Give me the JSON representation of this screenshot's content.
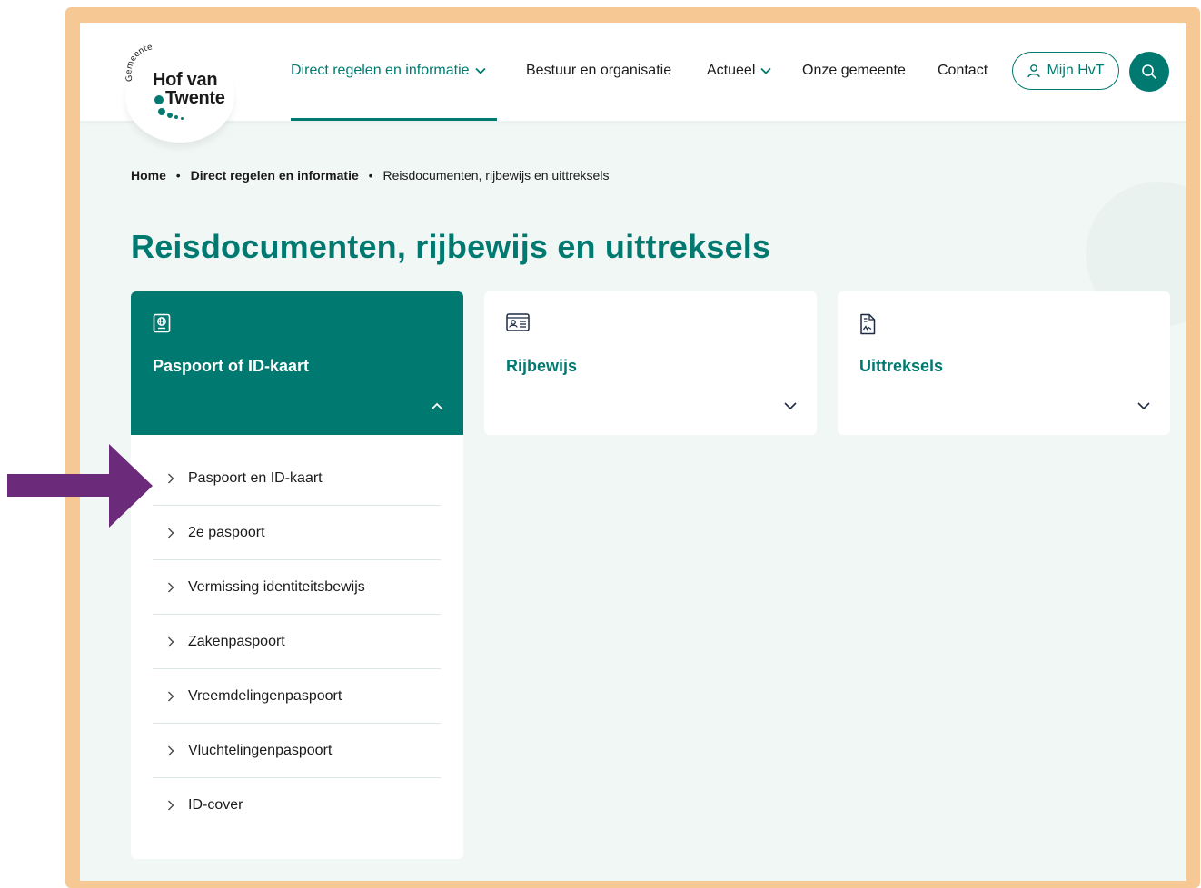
{
  "colors": {
    "brand": "#007a70",
    "frame": "#f5c894",
    "background": "#f1f7f5",
    "pointer_arrow": "#6b2a7a"
  },
  "logo": {
    "small": "Gemeente",
    "line1": "Hof van",
    "line2": "Twente"
  },
  "nav": {
    "items": [
      {
        "label": "Direct regelen en informatie",
        "active": true,
        "has_dropdown": true
      },
      {
        "label": "Bestuur en organisatie",
        "active": false,
        "has_dropdown": false
      },
      {
        "label": "Actueel",
        "active": false,
        "has_dropdown": true
      },
      {
        "label": "Onze gemeente",
        "active": false,
        "has_dropdown": false
      },
      {
        "label": "Contact",
        "active": false,
        "has_dropdown": false
      }
    ],
    "account_label": "Mijn HvT",
    "account_icon": "user-icon",
    "search_icon": "search-icon"
  },
  "breadcrumb": {
    "home": "Home",
    "section": "Direct regelen en informatie",
    "current": "Reisdocumenten, rijbewijs en uittreksels"
  },
  "page_title": "Reisdocumenten, rijbewijs en uittreksels",
  "cards": [
    {
      "title": "Paspoort of ID-kaart",
      "icon": "passport-icon",
      "expanded": true
    },
    {
      "title": "Rijbewijs",
      "icon": "id-card-icon",
      "expanded": false
    },
    {
      "title": "Uittreksels",
      "icon": "document-icon",
      "expanded": false
    }
  ],
  "paspoort_links": [
    "Paspoort en ID-kaart",
    "2e paspoort",
    "Vermissing identiteitsbewijs",
    "Zakenpaspoort",
    "Vreemdelingenpaspoort",
    "Vluchtelingenpaspoort",
    "ID-cover"
  ]
}
